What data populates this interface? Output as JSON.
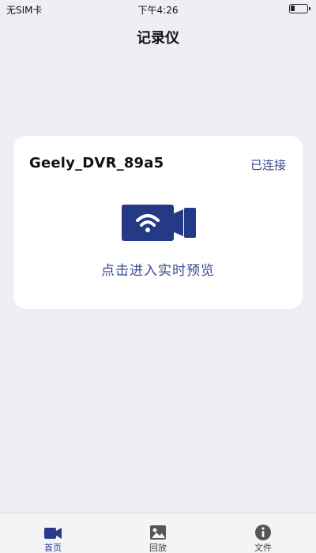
{
  "status_bar": {
    "carrier": "无SIM卡",
    "time": "下午4:26",
    "battery_level": 0.25
  },
  "header": {
    "title": "记录仪"
  },
  "device_card": {
    "device_name": "Geely_DVR_89a5",
    "connection_status": "已连接",
    "icon": "wifi-camera-icon",
    "preview_label": "点击进入实时预览"
  },
  "tab_bar": {
    "selected": "home",
    "tabs": [
      {
        "id": "home",
        "label": "首页",
        "icon": "camera-icon"
      },
      {
        "id": "playback",
        "label": "回放",
        "icon": "image-icon"
      },
      {
        "id": "files",
        "label": "文件",
        "icon": "info-icon"
      }
    ]
  },
  "colors": {
    "accent": "#243a86",
    "text_accent": "#3a4a8c",
    "background": "#efeef4",
    "card": "#ffffff"
  }
}
